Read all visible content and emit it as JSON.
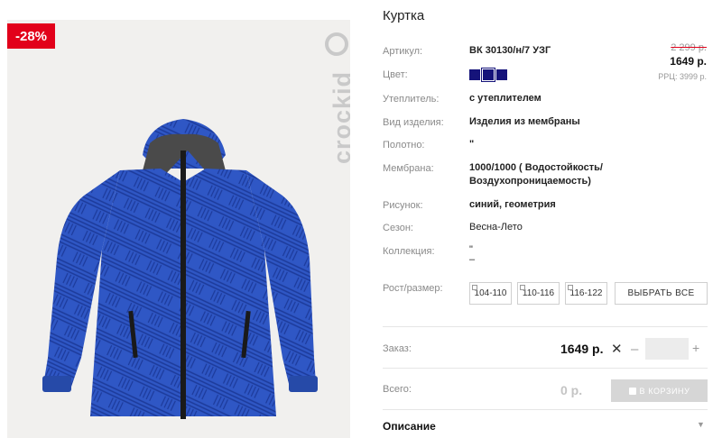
{
  "product": {
    "title": "Куртка",
    "discount_badge": "-28%",
    "brand": "crockid"
  },
  "pricing": {
    "old_price": "2 299 р.",
    "new_price": "1649 р.",
    "rrp": "РРЦ: 3999 р."
  },
  "specs": {
    "article_label": "Артикул:",
    "article_value": "ВК 30130/н/7 УЗГ",
    "color_label": "Цвет:",
    "insulation_label": "Утеплитель:",
    "insulation_value": "с утеплителем",
    "type_label": "Вид изделия:",
    "type_value": "Изделия из мембраны",
    "fabric_label": "Полотно:",
    "fabric_value": "\"",
    "membrane_label": "Мембрана:",
    "membrane_value_1": "1000/1000 ( Водостойкость/",
    "membrane_value_2": "Воздухопроницаемость)",
    "pattern_label": "Рисунок:",
    "pattern_value": "синий, геометрия",
    "season_label": "Сезон:",
    "season_value": "Весна-Лето",
    "collection_label": "Коллекция:",
    "collection_value_1": "\"",
    "collection_value_2": "–",
    "size_label": "Рост/размер:"
  },
  "colors": {
    "swatch": "#15137a",
    "accent": "#e2001a"
  },
  "sizes": [
    "104-110",
    "110-116",
    "116-122"
  ],
  "select_all": "ВЫБРАТЬ ВСЕ",
  "order": {
    "label": "Заказ:",
    "price": "1649 р.",
    "times": "✕",
    "minus": "–",
    "plus": "+",
    "qty_value": ""
  },
  "total": {
    "label": "Всего:",
    "value": "0 р.",
    "cart_button": "В КОРЗИНУ"
  },
  "description": {
    "label": "Описание",
    "arrow": "▼"
  }
}
